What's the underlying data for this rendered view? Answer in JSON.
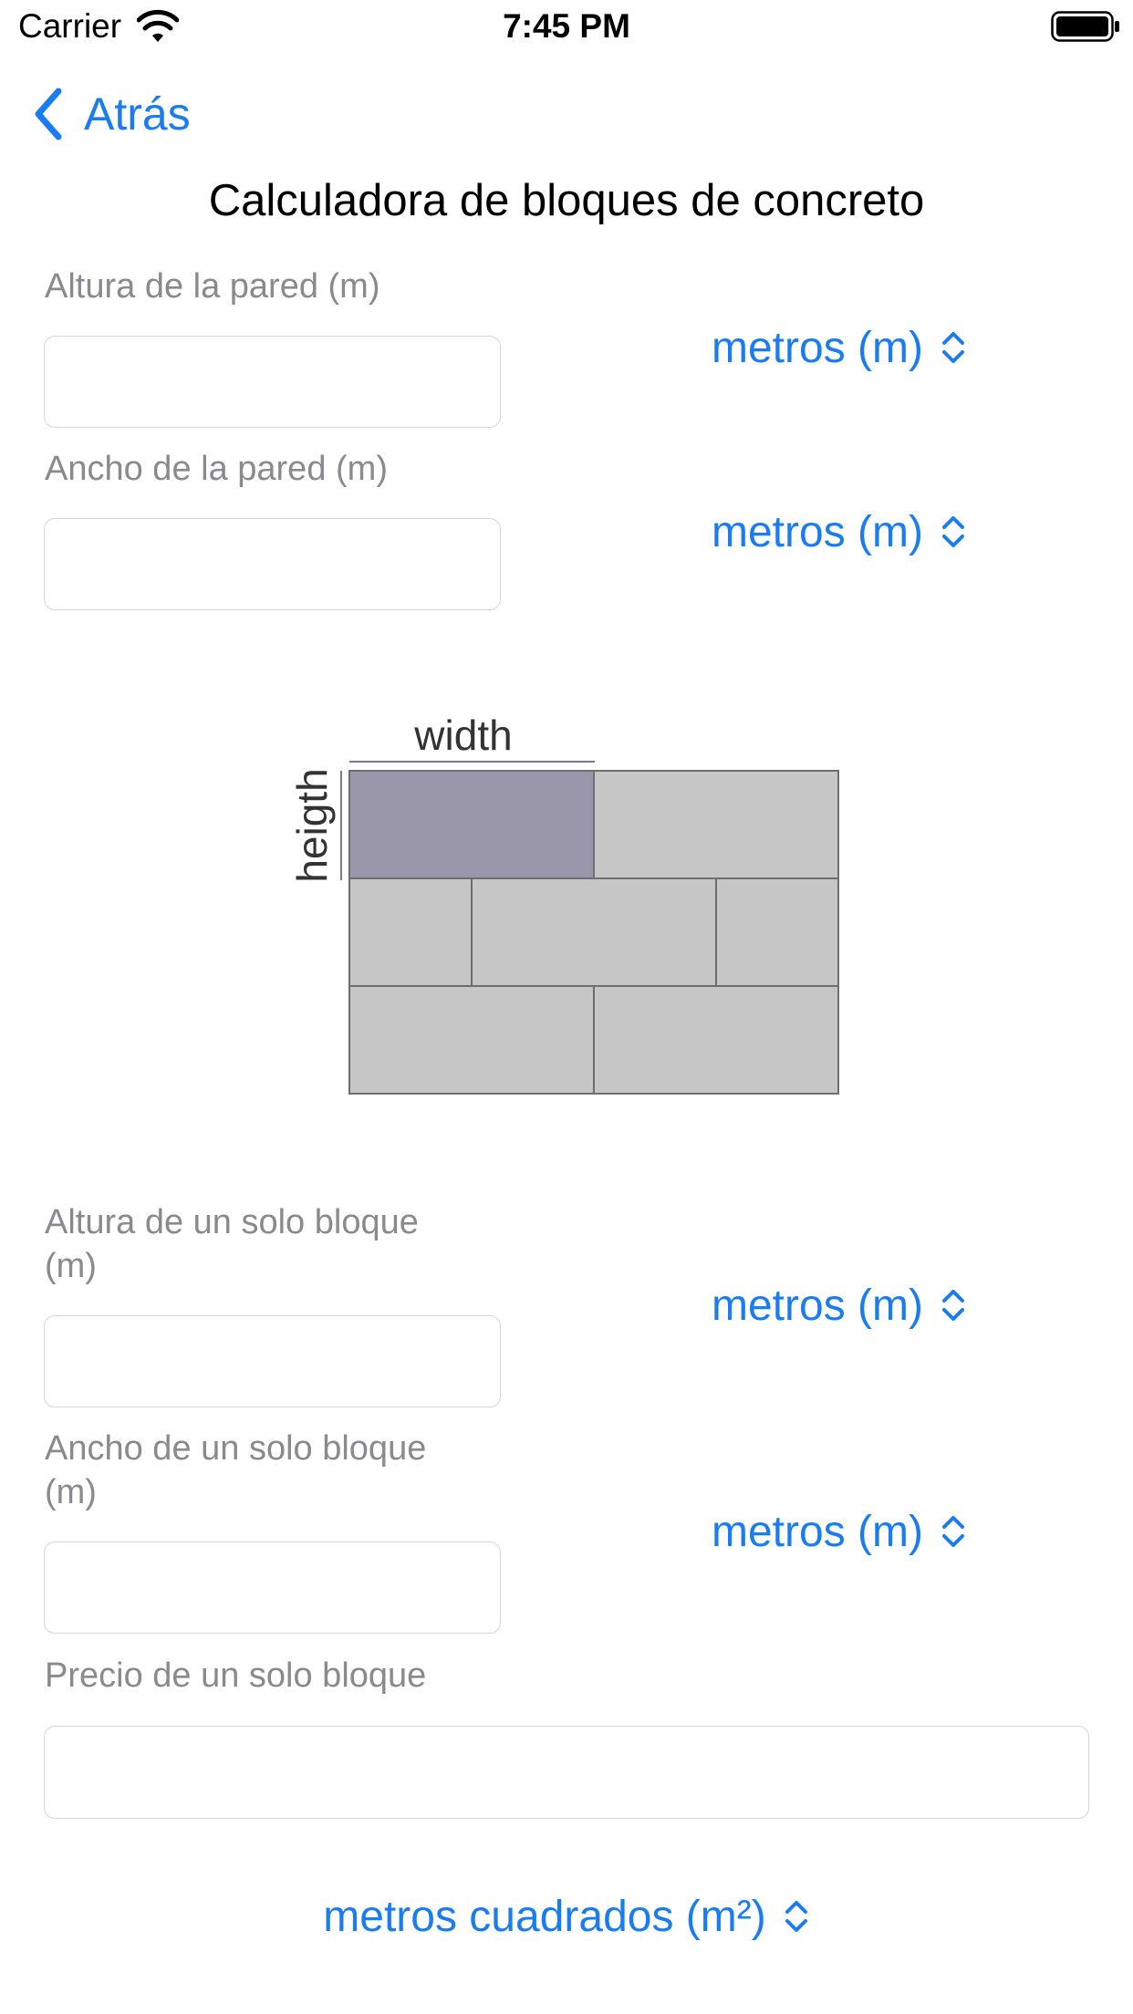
{
  "status_bar": {
    "carrier": "Carrier",
    "time": "7:45 PM",
    "wifi_icon": "wifi-icon",
    "battery_icon": "battery-icon"
  },
  "nav": {
    "back_label": "Atrás",
    "back_icon": "chevron-left-icon",
    "title": "Calculadora de bloques de concreto"
  },
  "fields": {
    "wall_height": {
      "label": "Altura de la pared (m)",
      "value": "",
      "unit": "metros (m)"
    },
    "wall_width": {
      "label": "Ancho de la pared (m)",
      "value": "",
      "unit": "metros (m)"
    },
    "block_height": {
      "label_line1": "Altura de un solo bloque",
      "label_line2": "(m)",
      "value": "",
      "unit": "metros (m)"
    },
    "block_width": {
      "label_line1": "Ancho de un solo bloque",
      "label_line2": "(m)",
      "value": "",
      "unit": "metros (m)"
    },
    "block_price": {
      "label": "Precio de un solo bloque",
      "value": ""
    }
  },
  "diagram": {
    "width_label": "width",
    "height_label": "heigth"
  },
  "area_unit": "metros cuadrados (m²)",
  "colors": {
    "accent": "#1a7cf2",
    "label_gray": "#8a8a8e",
    "block_fill": "#c6c6c6",
    "highlight_block": "#9a97aa",
    "block_stroke": "#6e6e6e"
  }
}
